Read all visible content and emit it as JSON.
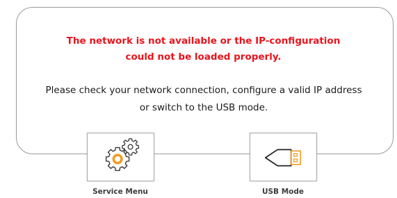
{
  "error": {
    "line1": "The network is not available or the IP-configuration",
    "line2": "could not be loaded properly."
  },
  "info": {
    "line1": "Please check your network connection, configure a valid IP address",
    "line2": "or switch to the USB mode."
  },
  "actions": [
    {
      "label": "Service Menu",
      "icon": "gears-icon"
    },
    {
      "label": "USB Mode",
      "icon": "usb-plug-icon"
    }
  ],
  "colors": {
    "error_text": "#e8141c",
    "accent_orange": "#f39a1e",
    "border": "#9a9a9a"
  }
}
